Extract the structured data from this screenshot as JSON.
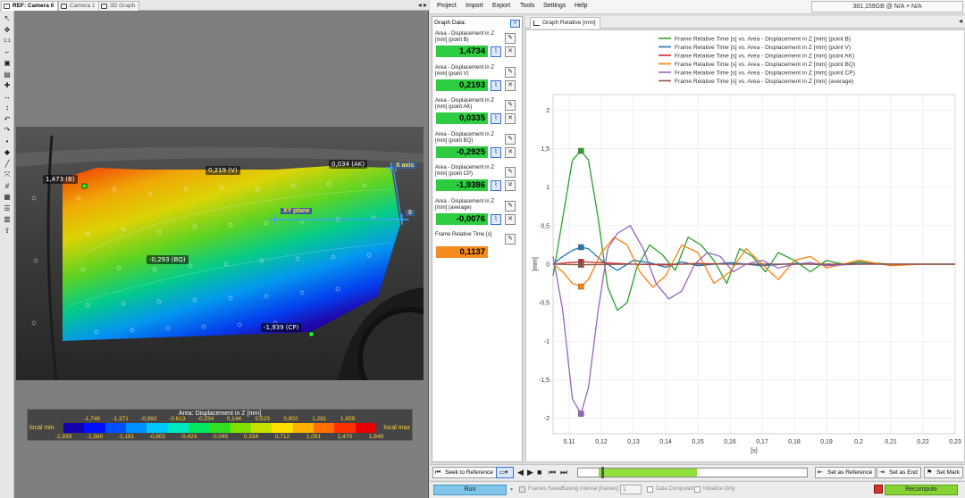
{
  "left_tabs": [
    {
      "label": "REF: Camera 0",
      "active": true
    },
    {
      "label": "Camera 1",
      "active": false
    },
    {
      "label": "3D Graph",
      "active": false
    }
  ],
  "left_nav": "◂ ▸",
  "toolbar_icons": [
    "select-icon",
    "move-icon",
    "zoom-1-1-icon",
    "crop-icon",
    "fit-icon",
    "image-icon",
    "zoom-in-icon",
    "pan-horizontal-icon",
    "pan-vertical-icon",
    "undo-icon",
    "redo-icon",
    "point-icon",
    "diamond-icon",
    "line-tool-icon",
    "stretch-icon",
    "grid-icon",
    "table-icon",
    "list-icon",
    "layers-icon",
    "export-icon"
  ],
  "toolbar_glyphs": [
    "↖",
    "✥",
    "1:1",
    "⌐",
    "▣",
    "▤",
    "✚",
    "↔",
    "↕",
    "↶",
    "↷",
    "•",
    "◆",
    "╱",
    "⤧",
    "#",
    "▦",
    "☰",
    "▥",
    "⇪"
  ],
  "toolbar_label_11": "1:1",
  "point_labels": [
    {
      "id": "B",
      "text": "1,473 (B)"
    },
    {
      "id": "V",
      "text": "0,219 (V)"
    },
    {
      "id": "AK",
      "text": "0,034 (AK)"
    },
    {
      "id": "BQ",
      "text": "-0,293 (BQ)"
    },
    {
      "id": "CP",
      "text": "-1,939 (CP)"
    }
  ],
  "axis_labels": {
    "x": "X axis",
    "xy": "XY plane",
    "origin": "0"
  },
  "colorbar": {
    "title": "Area: Displacement in Z [mm]",
    "min_label": "local min",
    "max_label": "local max",
    "ticks_top": [
      "-1,749",
      "-1,371",
      "-0,992",
      "-0,613",
      "-0,234",
      "0,144",
      "0,523",
      "0,902",
      "1,281",
      "1,659"
    ],
    "ticks_bottom": [
      "-1,939",
      "-1,560",
      "-1,181",
      "-0,802",
      "-0,424",
      "-0,045",
      "0,334",
      "0,712",
      "1,091",
      "1,470",
      "1,849"
    ],
    "colors": [
      "#1500b0",
      "#0010ff",
      "#0050ff",
      "#0090ff",
      "#00c8ff",
      "#00e8c0",
      "#00e860",
      "#30e020",
      "#80e000",
      "#c8e000",
      "#ffe000",
      "#ffb000",
      "#ff7000",
      "#ff3000",
      "#e80000"
    ]
  },
  "menu": [
    "Project",
    "Import",
    "Export",
    "Tools",
    "Settings",
    "Help"
  ],
  "memory": "381,159GB @ N/A × N/A",
  "data_panel": {
    "header": "Graph Data:",
    "collapse": "«",
    "items": [
      {
        "label": "Area - Displacement in Z [mm] (point B)",
        "value": "1,4734",
        "color": "green"
      },
      {
        "label": "Area - Displacement in Z [mm] (point V)",
        "value": "0,2193",
        "color": "green"
      },
      {
        "label": "Area - Displacement in Z [mm] (point AK)",
        "value": "0,0335",
        "color": "green"
      },
      {
        "label": "Area - Displacement in Z [mm] (point BQ)",
        "value": "-0,2925",
        "color": "green"
      },
      {
        "label": "Area - Displacement in Z [mm] (point CP)",
        "value": "-1,9386",
        "color": "green"
      },
      {
        "label": "Area - Displacement in Z [mm] (average)",
        "value": "-0,0076",
        "color": "green"
      },
      {
        "label": "Frame Relative Time [s]",
        "value": "0,1137",
        "color": "orange"
      }
    ]
  },
  "graph_tab": "Graph Relative [mm]",
  "graph_nav": "◂",
  "chart_data": {
    "type": "line",
    "title": "",
    "xlabel": "[s]",
    "ylabel": "[mm]",
    "xlim": [
      0.105,
      0.23
    ],
    "ylim": [
      -2.2,
      2.2
    ],
    "x_ticks": [
      "0,11",
      "0,12",
      "0,13",
      "0,14",
      "0,15",
      "0,16",
      "0,17",
      "0,18",
      "0,19",
      "0,2",
      "0,21",
      "0,22",
      "0,23"
    ],
    "y_ticks": [
      "2",
      "1,5",
      "1",
      "0,5",
      "0",
      "-0,5",
      "-1",
      "-1,5",
      "-2"
    ],
    "grid": true,
    "legend_position": "top-center",
    "cursor_x": 0.1137,
    "series": [
      {
        "name": "Frame Relative Time [s] vs. Area - Displacement in Z [mm] (point B)",
        "color": "#2ca02c",
        "x": [
          0.105,
          0.108,
          0.111,
          0.1137,
          0.116,
          0.119,
          0.122,
          0.125,
          0.128,
          0.131,
          0.135,
          0.139,
          0.143,
          0.147,
          0.151,
          0.155,
          0.159,
          0.163,
          0.167,
          0.171,
          0.175,
          0.18,
          0.185,
          0.19,
          0.195,
          0.2,
          0.21,
          0.22,
          0.23
        ],
        "y": [
          -0.15,
          0.6,
          1.35,
          1.47,
          1.35,
          0.6,
          -0.3,
          -0.6,
          -0.5,
          -0.05,
          0.25,
          0.12,
          -0.08,
          0.35,
          0.25,
          0.05,
          -0.25,
          0.2,
          0.1,
          -0.1,
          0.15,
          0.05,
          -0.1,
          0.05,
          0.0,
          0.03,
          0.0,
          0.0,
          0.0
        ]
      },
      {
        "name": "Frame Relative Time [s] vs. Area - Displacement in Z [mm] (point V)",
        "color": "#1f77b4",
        "x": [
          0.105,
          0.108,
          0.111,
          0.1137,
          0.116,
          0.12,
          0.125,
          0.13,
          0.135,
          0.14,
          0.145,
          0.15,
          0.16,
          0.17,
          0.18,
          0.19,
          0.2,
          0.21,
          0.22,
          0.23
        ],
        "y": [
          0.0,
          0.1,
          0.18,
          0.22,
          0.2,
          0.05,
          -0.08,
          0.05,
          0.02,
          -0.04,
          0.03,
          -0.02,
          0.02,
          -0.02,
          0.01,
          -0.01,
          0.01,
          0.0,
          0.0,
          0.0
        ]
      },
      {
        "name": "Frame Relative Time [s] vs. Area - Displacement in Z [mm] (point AK)",
        "color": "#d62728",
        "x": [
          0.105,
          0.11,
          0.1137,
          0.12,
          0.13,
          0.14,
          0.15,
          0.16,
          0.18,
          0.2,
          0.23
        ],
        "y": [
          0.0,
          0.02,
          0.03,
          0.02,
          0.0,
          -0.01,
          0.01,
          0.0,
          0.0,
          0.0,
          0.0
        ]
      },
      {
        "name": "Frame Relative Time [s] vs. Area - Displacement in Z [mm] (point BQ)",
        "color": "#ff7f0e",
        "x": [
          0.105,
          0.108,
          0.111,
          0.1137,
          0.116,
          0.12,
          0.124,
          0.128,
          0.132,
          0.136,
          0.14,
          0.145,
          0.15,
          0.155,
          0.16,
          0.165,
          0.17,
          0.175,
          0.18,
          0.185,
          0.19,
          0.2,
          0.21,
          0.22,
          0.23
        ],
        "y": [
          0.0,
          -0.1,
          -0.25,
          -0.29,
          -0.2,
          0.15,
          0.35,
          0.25,
          -0.1,
          -0.3,
          -0.15,
          0.25,
          0.15,
          -0.25,
          -0.1,
          0.2,
          0.0,
          -0.2,
          0.05,
          0.1,
          -0.05,
          0.05,
          -0.02,
          0.0,
          0.0
        ]
      },
      {
        "name": "Frame Relative Time [s] vs. Area - Displacement in Z [mm] (point CP)",
        "color": "#9467bd",
        "x": [
          0.105,
          0.108,
          0.111,
          0.1137,
          0.116,
          0.119,
          0.122,
          0.125,
          0.129,
          0.133,
          0.137,
          0.141,
          0.145,
          0.149,
          0.153,
          0.157,
          0.161,
          0.165,
          0.17,
          0.175,
          0.18,
          0.185,
          0.19,
          0.2,
          0.21,
          0.22,
          0.23
        ],
        "y": [
          0.1,
          -0.6,
          -1.75,
          -1.94,
          -1.6,
          -0.6,
          0.2,
          0.4,
          0.5,
          0.2,
          -0.25,
          -0.45,
          -0.35,
          0.0,
          0.15,
          0.1,
          -0.1,
          0.0,
          0.05,
          -0.05,
          0.0,
          0.02,
          -0.02,
          0.0,
          0.0,
          0.0,
          0.0
        ]
      },
      {
        "name": "Frame Relative Time [s] vs. Area - Displacement in Z [mm] (average)",
        "color": "#8c564b",
        "x": [
          0.105,
          0.1137,
          0.13,
          0.15,
          0.18,
          0.23
        ],
        "y": [
          0.0,
          -0.008,
          0.0,
          0.0,
          0.0,
          0.0
        ]
      }
    ]
  },
  "bottom1": {
    "seek_ref": "Seek to Reference",
    "set_ref": "Set as Reference",
    "set_end": "Set as End",
    "set_mark": "Set Mark",
    "timeline_start": 0.09,
    "timeline_end": 0.52,
    "timeline_cursor": 0.1
  },
  "bottom2": {
    "run": "Run",
    "frames_saved": "Frames Saved",
    "saving_interval": "Saving interval [frames]:",
    "interval_value": "1",
    "data_computed": "Data Computed",
    "initialize_only": "Initialize Only",
    "recompute": "Recompute"
  }
}
